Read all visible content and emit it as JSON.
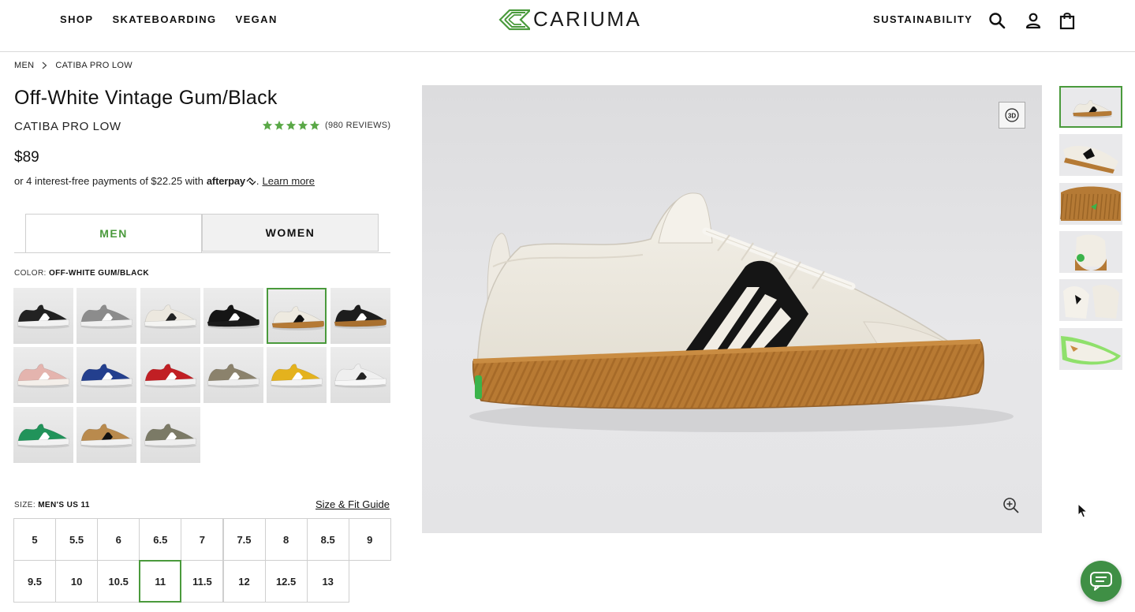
{
  "header": {
    "nav_left": [
      "SHOP",
      "SKATEBOARDING",
      "VEGAN"
    ],
    "brand": "CARIUMA",
    "nav_right": "SUSTAINABILITY",
    "icons": [
      "search-icon",
      "account-icon",
      "cart-icon"
    ]
  },
  "breadcrumb": [
    "MEN",
    "CATIBA PRO LOW"
  ],
  "product": {
    "title": "Off-White Vintage Gum/Black",
    "model": "CATIBA PRO LOW",
    "rating_stars": 5,
    "reviews": "(980 REVIEWS)",
    "price": "$89",
    "installments_text": "or 4 interest-free payments of $22.25 with",
    "afterpay": "afterpay",
    "learn_more": "Learn more"
  },
  "gender_tabs": [
    "MEN",
    "WOMEN"
  ],
  "gender_selected": "MEN",
  "color": {
    "label": "COLOR:",
    "value": "OFF-WHITE GUM/BLACK",
    "selected_index": 4,
    "swatches": [
      {
        "upper": "#222222",
        "sole": "#f2f2f2",
        "stripe": "#ffffff"
      },
      {
        "upper": "#8c8c8c",
        "sole": "#f0f0f0",
        "stripe": "#ffffff"
      },
      {
        "upper": "#ece8df",
        "sole": "#f4f4f2",
        "stripe": "#222222"
      },
      {
        "upper": "#151515",
        "sole": "#1c1c1c",
        "stripe": "#ffffff"
      },
      {
        "upper": "#eeeae0",
        "sole": "#b57a35",
        "stripe": "#111111"
      },
      {
        "upper": "#1d1d1d",
        "sole": "#a9702f",
        "stripe": "#ffffff"
      },
      {
        "upper": "#e4b4ae",
        "sole": "#f4efea",
        "stripe": "#ffffff"
      },
      {
        "upper": "#233f8e",
        "sole": "#f1f1f1",
        "stripe": "#ffffff"
      },
      {
        "upper": "#c11f24",
        "sole": "#f1f1f1",
        "stripe": "#ffffff"
      },
      {
        "upper": "#8b826c",
        "sole": "#eeeeee",
        "stripe": "#ffffff"
      },
      {
        "upper": "#e4b21d",
        "sole": "#f2f2f2",
        "stripe": "#ffffff"
      },
      {
        "upper": "#efefef",
        "sole": "#f7f7f7",
        "stripe": "#222222"
      },
      {
        "upper": "#21935a",
        "sole": "#f2f2f2",
        "stripe": "#ffffff"
      },
      {
        "upper": "#b98a4d",
        "sole": "#f2f2f2",
        "stripe": "#111111"
      },
      {
        "upper": "#7b7a66",
        "sole": "#efefef",
        "stripe": "#ffffff"
      }
    ]
  },
  "size": {
    "label": "SIZE:",
    "value": "MEN'S US 11",
    "guide": "Size & Fit Guide",
    "options": [
      "5",
      "5.5",
      "6",
      "6.5",
      "7",
      "7.5",
      "8",
      "8.5",
      "9",
      "9.5",
      "10",
      "10.5",
      "11",
      "11.5",
      "12",
      "12.5",
      "13"
    ],
    "selected": "11"
  },
  "gallery": {
    "button_3d": "3D",
    "thumbnails": 6,
    "selected_thumb": 0
  },
  "colors": {
    "accent_green": "#4a9a3c",
    "chat_green": "#3f8f45",
    "star_green": "#5aa847",
    "gum": "#b57a35"
  }
}
